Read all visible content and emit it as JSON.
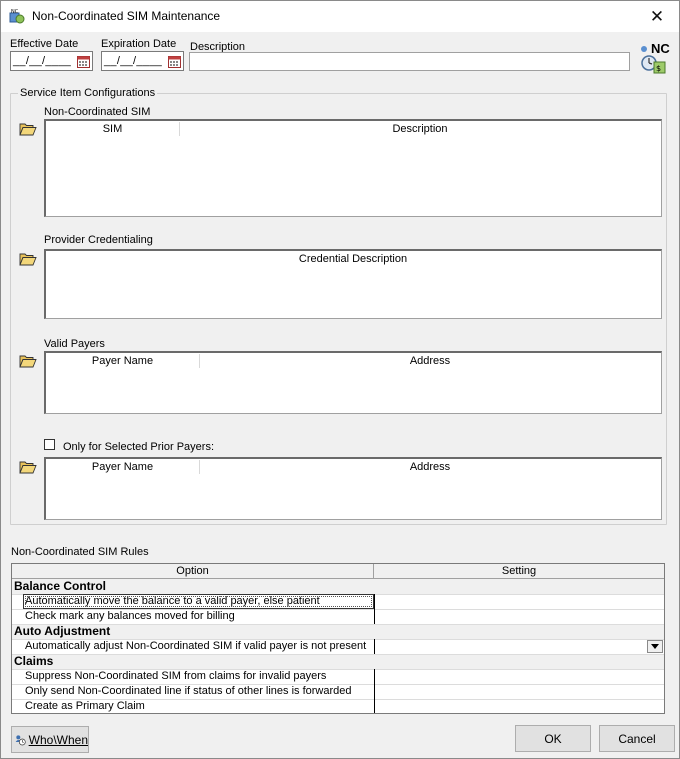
{
  "window": {
    "title": "Non-Coordinated SIM Maintenance",
    "close_glyph": "✕"
  },
  "header": {
    "effective_date_label": "Effective Date",
    "effective_date_value": "__/__/____",
    "expiration_date_label": "Expiration Date",
    "expiration_date_value": "__/__/____",
    "description_label": "Description",
    "description_value": "",
    "badge_text": "NC"
  },
  "service_items": {
    "legend": "Service Item Configurations",
    "non_coordinated_sim": {
      "label": "Non-Coordinated SIM",
      "columns": [
        "SIM",
        "Description"
      ]
    },
    "provider_credentialing": {
      "label": "Provider Credentialing",
      "columns": [
        "Credential Description"
      ]
    },
    "valid_payers": {
      "label": "Valid Payers",
      "columns": [
        "Payer Name",
        "Address"
      ]
    },
    "prior_payers": {
      "checkbox_label": "Only for Selected Prior Payers:",
      "checked": false,
      "columns": [
        "Payer Name",
        "Address"
      ]
    }
  },
  "rules": {
    "title": "Non-Coordinated SIM Rules",
    "columns": [
      "Option",
      "Setting"
    ],
    "rows": [
      {
        "kind": "category",
        "label": "Balance Control"
      },
      {
        "kind": "option",
        "label": "Automatically move the balance to a valid payer, else patient"
      },
      {
        "kind": "option",
        "label": "Check mark any balances moved for billing"
      },
      {
        "kind": "category",
        "label": "Auto Adjustment"
      },
      {
        "kind": "option",
        "label": "Automatically adjust Non-Coordinated SIM if valid payer is not present"
      },
      {
        "kind": "category",
        "label": "Claims"
      },
      {
        "kind": "option",
        "label": "Suppress Non-Coordinated SIM from claims for invalid payers"
      },
      {
        "kind": "option",
        "label": "Only send Non-Coordinated line if status of other lines is forwarded"
      },
      {
        "kind": "option",
        "label": "Create as Primary Claim"
      }
    ]
  },
  "footer": {
    "who_when_label": "Who\\When",
    "ok_label": "OK",
    "cancel_label": "Cancel"
  },
  "icons": {
    "app": "nc-app-icon",
    "close": "close-icon",
    "calendar": "calendar-icon",
    "folder": "open-folder-icon",
    "badge": "nc-badge-icon",
    "who_when": "who-when-icon",
    "dropdown": "chevron-down-icon"
  }
}
